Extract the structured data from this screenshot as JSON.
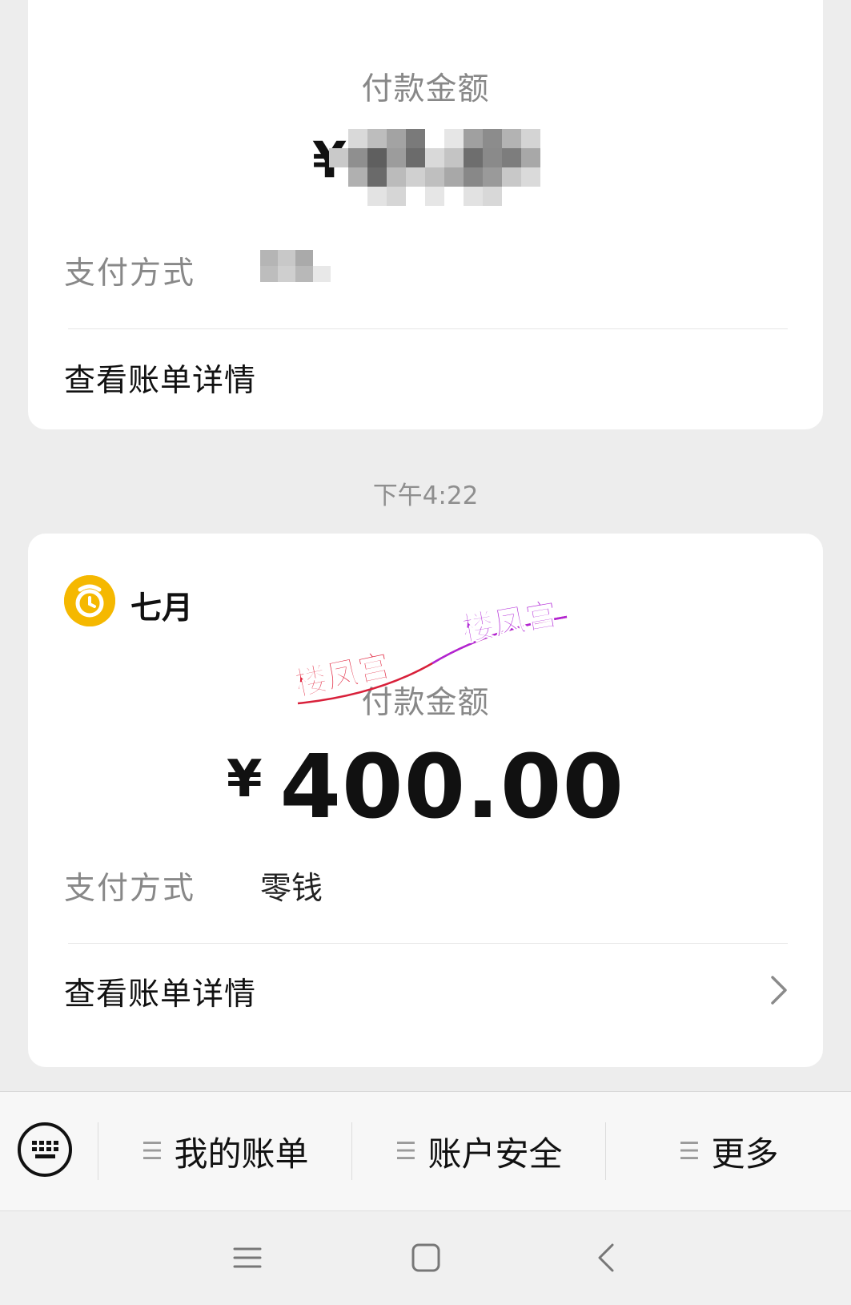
{
  "top_card": {
    "amount_label": "付款金额",
    "currency_symbol": "¥",
    "payment_method_label": "支付方式",
    "view_bill_label": "查看账单详情"
  },
  "timestamp": "下午4:22",
  "bottom_card": {
    "merchant_name": "七月",
    "avatar_icon": "alarm-clock-icon",
    "avatar_color": "#f5b800",
    "amount_label": "付款金额",
    "currency_symbol": "¥",
    "amount": "400.00",
    "payment_method_label": "支付方式",
    "payment_method_value": "零钱",
    "view_bill_label": "查看账单详情"
  },
  "watermark": {
    "text_left": "楼凤宫",
    "text_right": "楼凤宫",
    "color_left": "#e0203a",
    "color_right": "#b024d6"
  },
  "menu_bar": {
    "keyboard_icon": "keyboard-icon",
    "items": [
      {
        "label": "我的账单",
        "icon": "menu-lines-icon"
      },
      {
        "label": "账户安全",
        "icon": "menu-lines-icon"
      },
      {
        "label": "更多",
        "icon": "menu-lines-icon"
      }
    ]
  },
  "system_nav": {
    "icons": [
      "recent-apps-icon",
      "home-icon",
      "back-icon"
    ]
  }
}
